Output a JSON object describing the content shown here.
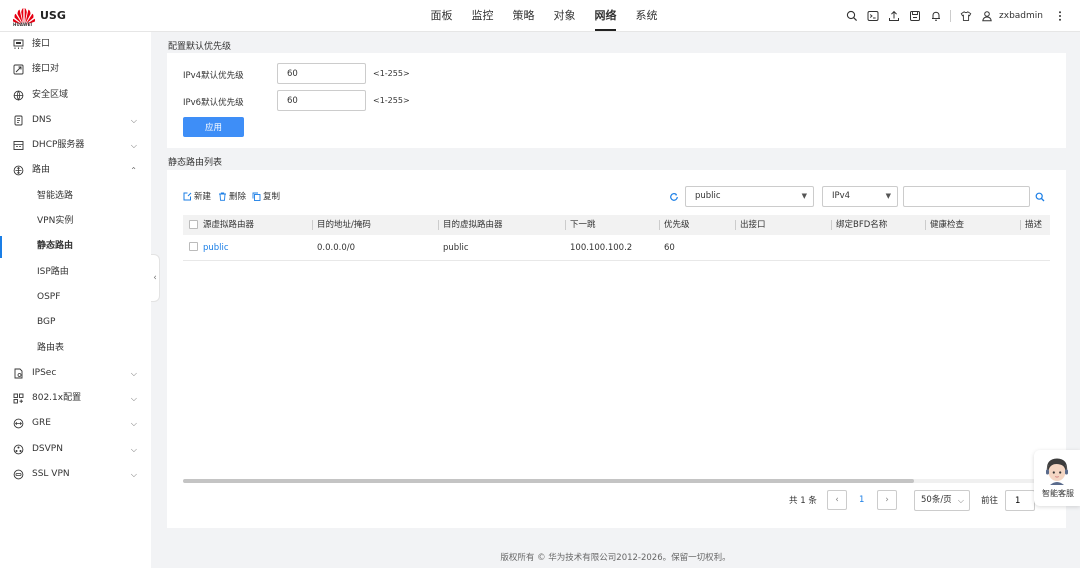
{
  "header": {
    "brand_text": "HUAWEI",
    "product": "USG",
    "nav": [
      "面板",
      "监控",
      "策略",
      "对象",
      "网络",
      "系统"
    ],
    "active_nav": "网络",
    "username": "zxbadmin"
  },
  "sidebar": {
    "items": [
      {
        "label": "接口"
      },
      {
        "label": "接口对"
      },
      {
        "label": "安全区域"
      },
      {
        "label": "DNS"
      },
      {
        "label": "DHCP服务器"
      },
      {
        "label": "路由"
      },
      {
        "label": "智能选路"
      },
      {
        "label": "VPN实例"
      },
      {
        "label": "静态路由"
      },
      {
        "label": "ISP路由"
      },
      {
        "label": "OSPF"
      },
      {
        "label": "BGP"
      },
      {
        "label": "路由表"
      },
      {
        "label": "IPSec"
      },
      {
        "label": "802.1x配置"
      },
      {
        "label": "GRE"
      },
      {
        "label": "DSVPN"
      },
      {
        "label": "SSL VPN"
      }
    ]
  },
  "priority": {
    "title": "配置默认优先级",
    "ipv4_label": "IPv4默认优先级",
    "ipv4_value": "60",
    "ipv6_label": "IPv6默认优先级",
    "ipv6_value": "60",
    "range": "<1-255>",
    "apply": "应用"
  },
  "routes": {
    "title": "静态路由列表",
    "actions": {
      "new": "新建",
      "delete": "删除",
      "copy": "复制"
    },
    "vrf_filter": "public",
    "ip_filter": "IPv4",
    "search_value": "",
    "columns": [
      "源虚拟路由器",
      "目的地址/掩码",
      "目的虚拟路由器",
      "下一跳",
      "优先级",
      "出接口",
      "绑定BFD名称",
      "健康检查",
      "描述"
    ],
    "rows": [
      {
        "src_vr": "public",
        "dest": "0.0.0.0/0",
        "dest_vr": "public",
        "next_hop": "100.100.100.2",
        "priority": "60",
        "out_if": "",
        "bfd": "",
        "health": "",
        "desc": ""
      }
    ]
  },
  "pager": {
    "total_prefix": "共",
    "total": "1",
    "total_suffix": "条",
    "current_page": "1",
    "page_size": "50条/页",
    "goto_label": "前往",
    "goto_value": "1"
  },
  "assistant": {
    "label": "智能客服"
  },
  "footer": {
    "copyright": "版权所有 © 华为技术有限公司2012-2026。保留一切权利。"
  },
  "colors": {
    "accent": "#3e8ef7",
    "link": "#1a7ee6",
    "brand": "#e60012"
  }
}
